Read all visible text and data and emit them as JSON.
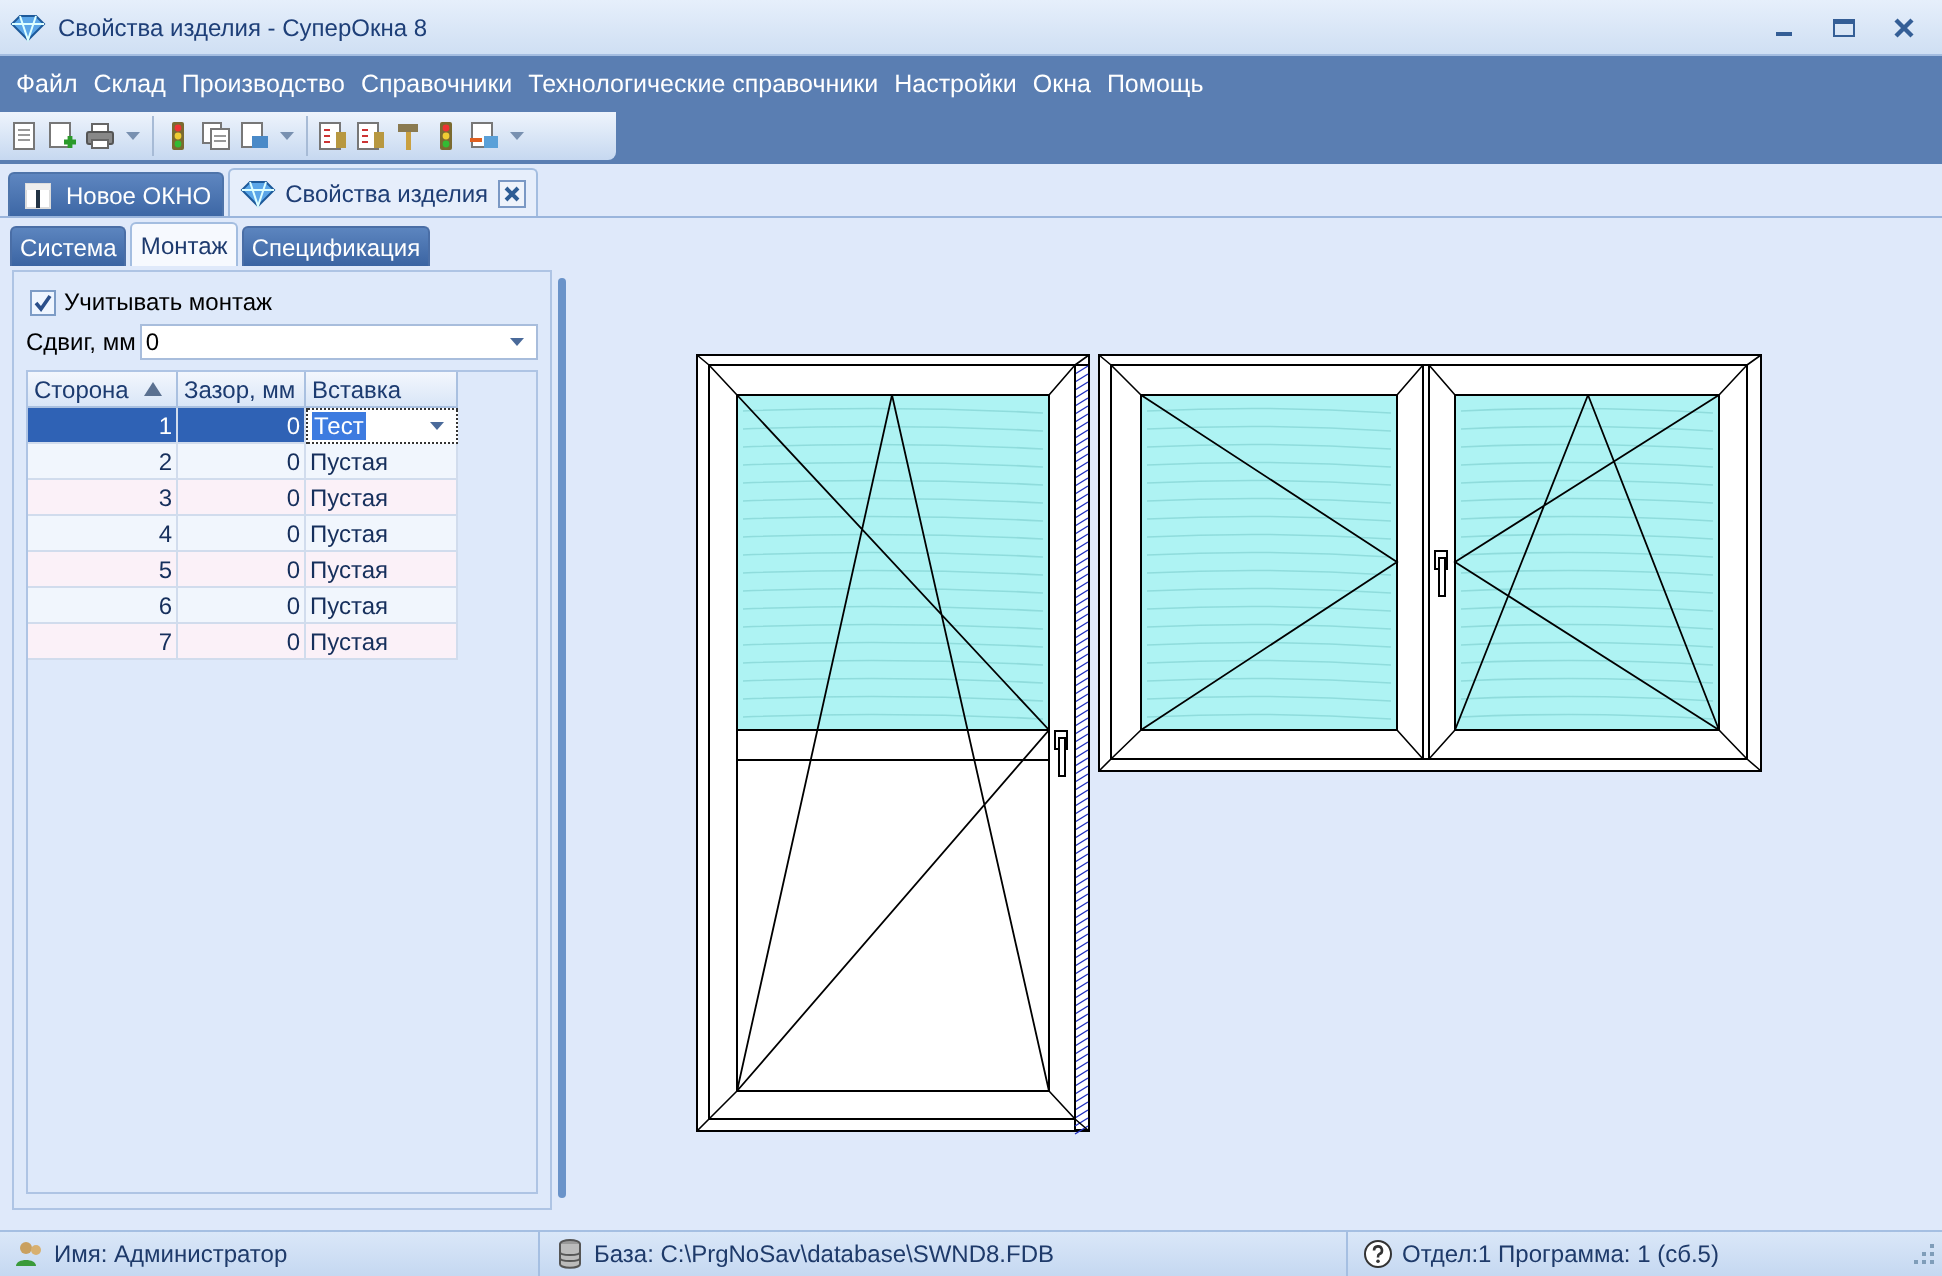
{
  "window": {
    "title": "Свойства изделия - СуперОкна 8"
  },
  "menu": [
    "Файл",
    "Склад",
    "Производство",
    "Справочники",
    "Технологические справочники",
    "Настройки",
    "Окна",
    "Помощь"
  ],
  "document_tabs": [
    {
      "label": "Новое ОКНО",
      "selected": false,
      "closable": false
    },
    {
      "label": "Свойства изделия",
      "selected": true,
      "closable": true
    }
  ],
  "tabs": [
    {
      "label": "Система",
      "selected": false
    },
    {
      "label": "Монтаж",
      "selected": true
    },
    {
      "label": "Спецификация",
      "selected": false
    }
  ],
  "mounting": {
    "checkbox": {
      "label": "Учитывать монтаж",
      "checked": true
    },
    "shift": {
      "label": "Сдвиг, мм",
      "value": "0"
    },
    "table": {
      "columns": [
        {
          "label": "Сторона",
          "sorted": true
        },
        {
          "label": "Зазор, мм",
          "sorted": false
        },
        {
          "label": "Вставка",
          "sorted": false
        }
      ],
      "rows": [
        {
          "side": "1",
          "gap": "0",
          "insert": "Тест",
          "selected": true
        },
        {
          "side": "2",
          "gap": "0",
          "insert": "Пустая",
          "selected": false
        },
        {
          "side": "3",
          "gap": "0",
          "insert": "Пустая",
          "selected": false
        },
        {
          "side": "4",
          "gap": "0",
          "insert": "Пустая",
          "selected": false
        },
        {
          "side": "5",
          "gap": "0",
          "insert": "Пустая",
          "selected": false
        },
        {
          "side": "6",
          "gap": "0",
          "insert": "Пустая",
          "selected": false
        },
        {
          "side": "7",
          "gap": "0",
          "insert": "Пустая",
          "selected": false
        }
      ]
    }
  },
  "status_bar": [
    "Имя: Администратор",
    "База: C:\\PrgNoSav\\database\\SWND8.FDB",
    "Отдел:1 Программа: 1 (сб.5)"
  ]
}
